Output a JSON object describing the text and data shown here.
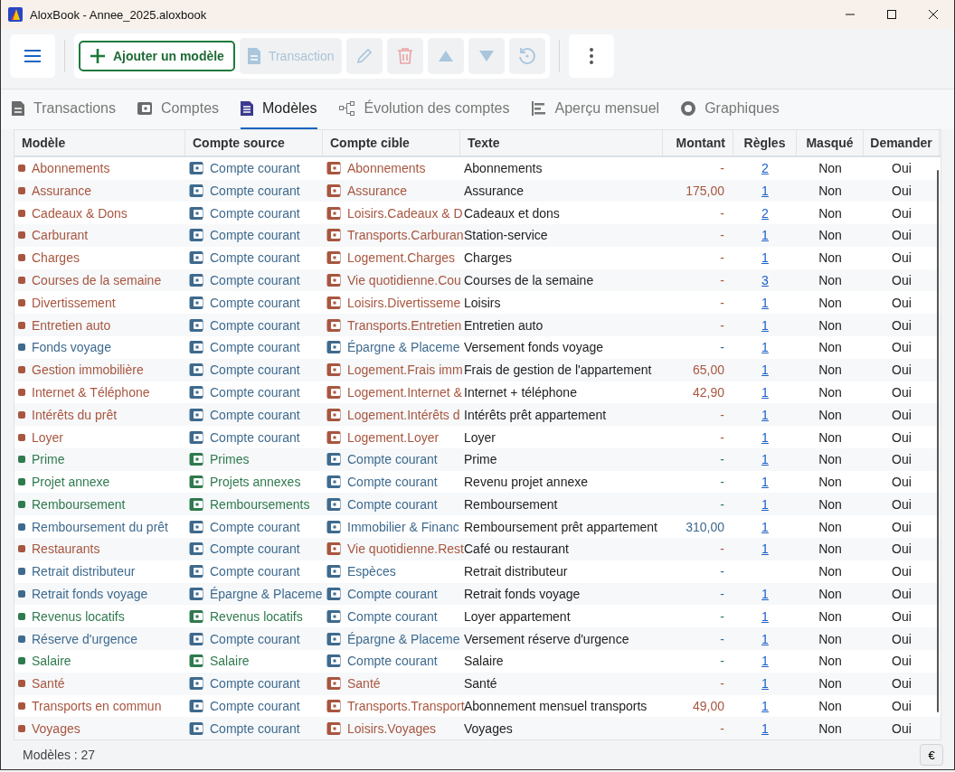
{
  "window": {
    "title": "AloxBook - Annee_2025.aloxbook"
  },
  "toolbar": {
    "groups": [
      {
        "buttons": [
          {
            "kind": "menu"
          }
        ]
      },
      {
        "buttons": [
          {
            "kind": "add",
            "label": "Ajouter un modèle",
            "disabled": false
          },
          {
            "kind": "transaction",
            "label": "Transaction",
            "disabled": true
          },
          {
            "kind": "edit",
            "disabled": true
          },
          {
            "kind": "delete",
            "disabled": true
          },
          {
            "kind": "up",
            "disabled": true
          },
          {
            "kind": "down",
            "disabled": true
          },
          {
            "kind": "history",
            "disabled": true
          }
        ]
      },
      {
        "buttons": [
          {
            "kind": "more"
          }
        ]
      }
    ]
  },
  "tabs": [
    {
      "label": "Transactions",
      "selected": false
    },
    {
      "label": "Comptes",
      "selected": false
    },
    {
      "label": "Modèles",
      "selected": true
    },
    {
      "label": "Évolution des comptes",
      "selected": false
    },
    {
      "label": "Aperçu mensuel",
      "selected": false
    },
    {
      "label": "Graphiques",
      "selected": false
    }
  ],
  "table": {
    "columns": [
      "Modèle",
      "Compte source",
      "Compte cible",
      "Texte",
      "Montant",
      "Règles",
      "Masqué",
      "Demander"
    ],
    "rows": [
      {
        "name": "Abonnements",
        "color": "#a8563f",
        "source": {
          "name": "Compte courant",
          "kind": "asset"
        },
        "target": {
          "name": "Abonnements",
          "kind": "expense"
        },
        "text": "Abonnements",
        "amount": "-",
        "rules": "2",
        "hidden": "Non",
        "ask": "Oui"
      },
      {
        "name": "Assurance",
        "color": "#a8563f",
        "source": {
          "name": "Compte courant",
          "kind": "asset"
        },
        "target": {
          "name": "Assurance",
          "kind": "expense"
        },
        "text": "Assurance",
        "amount": "175,00",
        "rules": "1",
        "hidden": "Non",
        "ask": "Oui"
      },
      {
        "name": "Cadeaux & Dons",
        "color": "#a8563f",
        "source": {
          "name": "Compte courant",
          "kind": "asset"
        },
        "target": {
          "name": "Loisirs.Cadeaux & D",
          "kind": "expense"
        },
        "text": "Cadeaux et dons",
        "amount": "-",
        "rules": "2",
        "hidden": "Non",
        "ask": "Oui"
      },
      {
        "name": "Carburant",
        "color": "#a8563f",
        "source": {
          "name": "Compte courant",
          "kind": "asset"
        },
        "target": {
          "name": "Transports.Carburan",
          "kind": "expense"
        },
        "text": "Station-service",
        "amount": "-",
        "rules": "1",
        "hidden": "Non",
        "ask": "Oui"
      },
      {
        "name": "Charges",
        "color": "#a8563f",
        "source": {
          "name": "Compte courant",
          "kind": "asset"
        },
        "target": {
          "name": "Logement.Charges",
          "kind": "expense"
        },
        "text": "Charges",
        "amount": "-",
        "rules": "1",
        "hidden": "Non",
        "ask": "Oui"
      },
      {
        "name": "Courses de la semaine",
        "color": "#a8563f",
        "source": {
          "name": "Compte courant",
          "kind": "asset"
        },
        "target": {
          "name": "Vie quotidienne.Cou",
          "kind": "expense"
        },
        "text": "Courses de la semaine",
        "amount": "-",
        "rules": "3",
        "hidden": "Non",
        "ask": "Oui"
      },
      {
        "name": "Divertissement",
        "color": "#a8563f",
        "source": {
          "name": "Compte courant",
          "kind": "asset"
        },
        "target": {
          "name": "Loisirs.Divertisseme",
          "kind": "expense"
        },
        "text": "Loisirs",
        "amount": "-",
        "rules": "1",
        "hidden": "Non",
        "ask": "Oui"
      },
      {
        "name": "Entretien auto",
        "color": "#a8563f",
        "source": {
          "name": "Compte courant",
          "kind": "asset"
        },
        "target": {
          "name": "Transports.Entretien",
          "kind": "expense"
        },
        "text": "Entretien auto",
        "amount": "-",
        "rules": "1",
        "hidden": "Non",
        "ask": "Oui"
      },
      {
        "name": "Fonds voyage",
        "color": "#3e6a8e",
        "source": {
          "name": "Compte courant",
          "kind": "asset"
        },
        "target": {
          "name": "Épargne & Placeme",
          "kind": "asset"
        },
        "text": "Versement fonds voyage",
        "amount": "-",
        "rules": "1",
        "hidden": "Non",
        "ask": "Oui"
      },
      {
        "name": "Gestion immobilière",
        "color": "#a8563f",
        "source": {
          "name": "Compte courant",
          "kind": "asset"
        },
        "target": {
          "name": "Logement.Frais imm",
          "kind": "expense"
        },
        "text": "Frais de gestion de l'appartement",
        "amount": "65,00",
        "rules": "1",
        "hidden": "Non",
        "ask": "Oui"
      },
      {
        "name": "Internet & Téléphone",
        "color": "#a8563f",
        "source": {
          "name": "Compte courant",
          "kind": "asset"
        },
        "target": {
          "name": "Logement.Internet &",
          "kind": "expense"
        },
        "text": "Internet + téléphone",
        "amount": "42,90",
        "rules": "1",
        "hidden": "Non",
        "ask": "Oui"
      },
      {
        "name": "Intérêts du prêt",
        "color": "#a8563f",
        "source": {
          "name": "Compte courant",
          "kind": "asset"
        },
        "target": {
          "name": "Logement.Intérêts d",
          "kind": "expense"
        },
        "text": "Intérêts prêt appartement",
        "amount": "-",
        "rules": "1",
        "hidden": "Non",
        "ask": "Oui"
      },
      {
        "name": "Loyer",
        "color": "#a8563f",
        "source": {
          "name": "Compte courant",
          "kind": "asset"
        },
        "target": {
          "name": "Logement.Loyer",
          "kind": "expense"
        },
        "text": "Loyer",
        "amount": "-",
        "rules": "1",
        "hidden": "Non",
        "ask": "Oui"
      },
      {
        "name": "Prime",
        "color": "#2f7a4e",
        "source": {
          "name": "Primes",
          "kind": "income"
        },
        "target": {
          "name": "Compte courant",
          "kind": "asset"
        },
        "text": "Prime",
        "amount": "-",
        "rules": "1",
        "hidden": "Non",
        "ask": "Oui"
      },
      {
        "name": "Projet annexe",
        "color": "#2f7a4e",
        "source": {
          "name": "Projets annexes",
          "kind": "income"
        },
        "target": {
          "name": "Compte courant",
          "kind": "asset"
        },
        "text": "Revenu projet annexe",
        "amount": "-",
        "rules": "1",
        "hidden": "Non",
        "ask": "Oui"
      },
      {
        "name": "Remboursement",
        "color": "#2f7a4e",
        "source": {
          "name": "Remboursements",
          "kind": "income"
        },
        "target": {
          "name": "Compte courant",
          "kind": "asset"
        },
        "text": "Remboursement",
        "amount": "-",
        "rules": "1",
        "hidden": "Non",
        "ask": "Oui"
      },
      {
        "name": "Remboursement du prêt",
        "color": "#3e6a8e",
        "source": {
          "name": "Compte courant",
          "kind": "asset"
        },
        "target": {
          "name": "Immobilier & Financ",
          "kind": "asset"
        },
        "text": "Remboursement prêt appartement",
        "amount": "310,00",
        "rules": "1",
        "hidden": "Non",
        "ask": "Oui"
      },
      {
        "name": "Restaurants",
        "color": "#a8563f",
        "source": {
          "name": "Compte courant",
          "kind": "asset"
        },
        "target": {
          "name": "Vie quotidienne.Rest",
          "kind": "expense"
        },
        "text": "Café ou restaurant",
        "amount": "-",
        "rules": "1",
        "hidden": "Non",
        "ask": "Oui"
      },
      {
        "name": "Retrait distributeur",
        "color": "#3e6a8e",
        "source": {
          "name": "Compte courant",
          "kind": "asset"
        },
        "target": {
          "name": "Espèces",
          "kind": "asset"
        },
        "text": "Retrait distributeur",
        "amount": "-",
        "hidden": "Non",
        "ask": "Oui"
      },
      {
        "name": "Retrait fonds voyage",
        "color": "#3e6a8e",
        "source": {
          "name": "Épargne & Placeme",
          "kind": "asset"
        },
        "target": {
          "name": "Compte courant",
          "kind": "asset"
        },
        "text": "Retrait fonds voyage",
        "amount": "-",
        "rules": "1",
        "hidden": "Non",
        "ask": "Oui"
      },
      {
        "name": "Revenus locatifs",
        "color": "#2f7a4e",
        "source": {
          "name": "Revenus locatifs",
          "kind": "income"
        },
        "target": {
          "name": "Compte courant",
          "kind": "asset"
        },
        "text": "Loyer appartement",
        "amount": "-",
        "rules": "1",
        "hidden": "Non",
        "ask": "Oui"
      },
      {
        "name": "Réserve d'urgence",
        "color": "#3e6a8e",
        "source": {
          "name": "Compte courant",
          "kind": "asset"
        },
        "target": {
          "name": "Épargne & Placeme",
          "kind": "asset"
        },
        "text": "Versement réserve d'urgence",
        "amount": "-",
        "rules": "1",
        "hidden": "Non",
        "ask": "Oui"
      },
      {
        "name": "Salaire",
        "color": "#2f7a4e",
        "source": {
          "name": "Salaire",
          "kind": "income"
        },
        "target": {
          "name": "Compte courant",
          "kind": "asset"
        },
        "text": "Salaire",
        "amount": "-",
        "rules": "1",
        "hidden": "Non",
        "ask": "Oui"
      },
      {
        "name": "Santé",
        "color": "#a8563f",
        "source": {
          "name": "Compte courant",
          "kind": "asset"
        },
        "target": {
          "name": "Santé",
          "kind": "expense"
        },
        "text": "Santé",
        "amount": "-",
        "rules": "1",
        "hidden": "Non",
        "ask": "Oui"
      },
      {
        "name": "Transports en commun",
        "color": "#a8563f",
        "source": {
          "name": "Compte courant",
          "kind": "asset"
        },
        "target": {
          "name": "Transports.Transport",
          "kind": "expense"
        },
        "text": "Abonnement mensuel transports",
        "amount": "49,00",
        "rules": "1",
        "hidden": "Non",
        "ask": "Oui"
      },
      {
        "name": "Voyages",
        "color": "#a8563f",
        "source": {
          "name": "Compte courant",
          "kind": "asset"
        },
        "target": {
          "name": "Loisirs.Voyages",
          "kind": "expense"
        },
        "text": "Voyages",
        "amount": "-",
        "rules": "1",
        "hidden": "Non",
        "ask": "Oui"
      }
    ]
  },
  "status_bar": {
    "count": "Modèles : 27",
    "currency": "€"
  }
}
